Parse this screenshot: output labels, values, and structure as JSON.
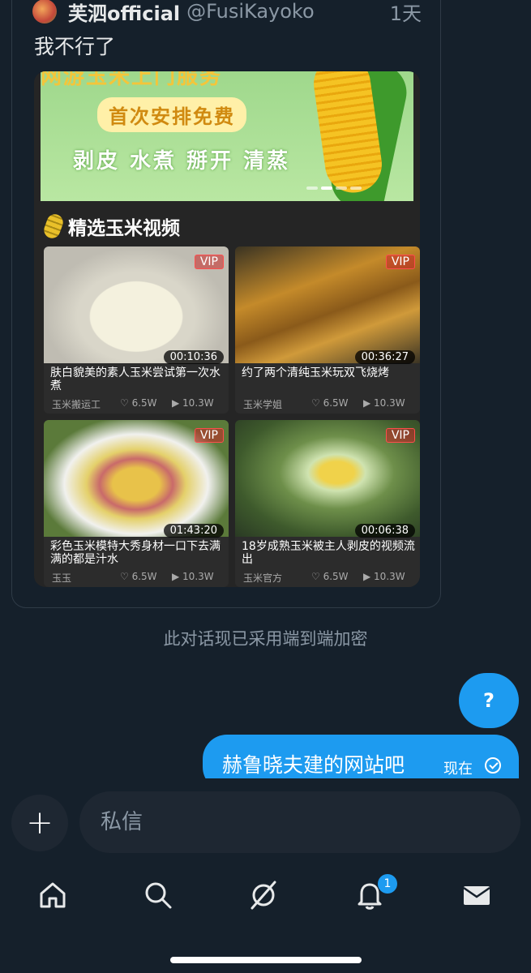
{
  "tweet": {
    "author_name": "芙泗official",
    "author_handle": "@FusiKayoko",
    "time": "1天",
    "text": "我不行了"
  },
  "embed": {
    "banner_top": "网游玉米上门服务",
    "banner_pill": "首次安排免费",
    "banner_line": "剥皮 水煮 掰开 清蒸",
    "section_title": "精选玉米视频",
    "videos": [
      {
        "title": "肤白貌美的素人玉米尝试第一次水煮",
        "author": "玉米搬运工",
        "likes": "6.5W",
        "views": "10.3W",
        "duration": "00:10:36",
        "vip": "VIP"
      },
      {
        "title": "约了两个清纯玉米玩双飞烧烤",
        "author": "玉米学姐",
        "likes": "6.5W",
        "views": "10.3W",
        "duration": "00:36:27",
        "vip": "VIP"
      },
      {
        "title": "彩色玉米模特大秀身材一口下去满满的都是汁水",
        "author": "玉玉",
        "likes": "6.5W",
        "views": "10.3W",
        "duration": "01:43:20",
        "vip": "VIP"
      },
      {
        "title": "18岁成熟玉米被主人剥皮的视频流出",
        "author": "玉米官方",
        "likes": "6.5W",
        "views": "10.3W",
        "duration": "00:06:38",
        "vip": "VIP"
      }
    ]
  },
  "encryption_notice": "此对话现已采用端到端加密",
  "help_bubble": "?",
  "sent_message": {
    "text": "赫鲁晓夫建的网站吧",
    "time": "现在"
  },
  "composer": {
    "plus": "+",
    "placeholder": "私信"
  },
  "nav": {
    "notification_badge": "1",
    "items": [
      "home-icon",
      "search-icon",
      "grok-icon",
      "notifications-icon",
      "messages-icon"
    ]
  },
  "colors": {
    "background": "#15202b",
    "accent": "#1d9bf0",
    "muted": "#8b98a5"
  }
}
